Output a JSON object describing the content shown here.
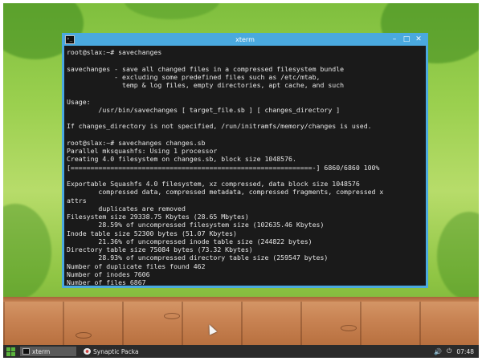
{
  "window": {
    "title": "xterm",
    "controls": {
      "minimize": "–",
      "maximize": "□",
      "close": "✕"
    }
  },
  "terminal": {
    "lines": [
      "root@slax:~# savechanges",
      "",
      "savechanges - save all changed files in a compressed filesystem bundle",
      "            - excluding some predefined files such as /etc/mtab,",
      "              temp & log files, empty directories, apt cache, and such",
      "",
      "Usage:",
      "        /usr/bin/savechanges [ target_file.sb ] [ changes_directory ]",
      "",
      "If changes_directory is not specified, /run/initramfs/memory/changes is used.",
      "",
      "root@slax:~# savechanges changes.sb",
      "Parallel mksquashfs: Using 1 processor",
      "Creating 4.0 filesystem on changes.sb, block size 1048576.",
      "[=============================================================-] 6860/6860 100%",
      "",
      "Exportable Squashfs 4.0 filesystem, xz compressed, data block size 1048576",
      "        compressed data, compressed metadata, compressed fragments, compressed x",
      "attrs",
      "        duplicates are removed",
      "Filesystem size 29338.75 Kbytes (28.65 Mbytes)",
      "        28.59% of uncompressed filesystem size (102635.46 Kbytes)",
      "Inode table size 52300 bytes (51.07 Kbytes)",
      "        21.36% of uncompressed inode table size (244822 bytes)",
      "Directory table size 75084 bytes (73.32 Kbytes)",
      "        28.93% of uncompressed directory table size (259547 bytes)",
      "Number of duplicate files found 462",
      "Number of inodes 7606",
      "Number of files 6867"
    ]
  },
  "taskbar": {
    "tasks": [
      {
        "label": "xterm",
        "icon": "terminal-icon"
      },
      {
        "label": "Synaptic Packa",
        "icon": "synaptic-icon"
      }
    ],
    "tray": {
      "volume": "🔊",
      "power": "⏻"
    },
    "clock": "07:48"
  },
  "colors": {
    "titlebar": "#4aa9df",
    "terminal_bg": "#1a1a1a",
    "terminal_fg": "#e6e6e6",
    "taskbar": "#2b2b2b",
    "start_icon": "#5bb33d"
  }
}
